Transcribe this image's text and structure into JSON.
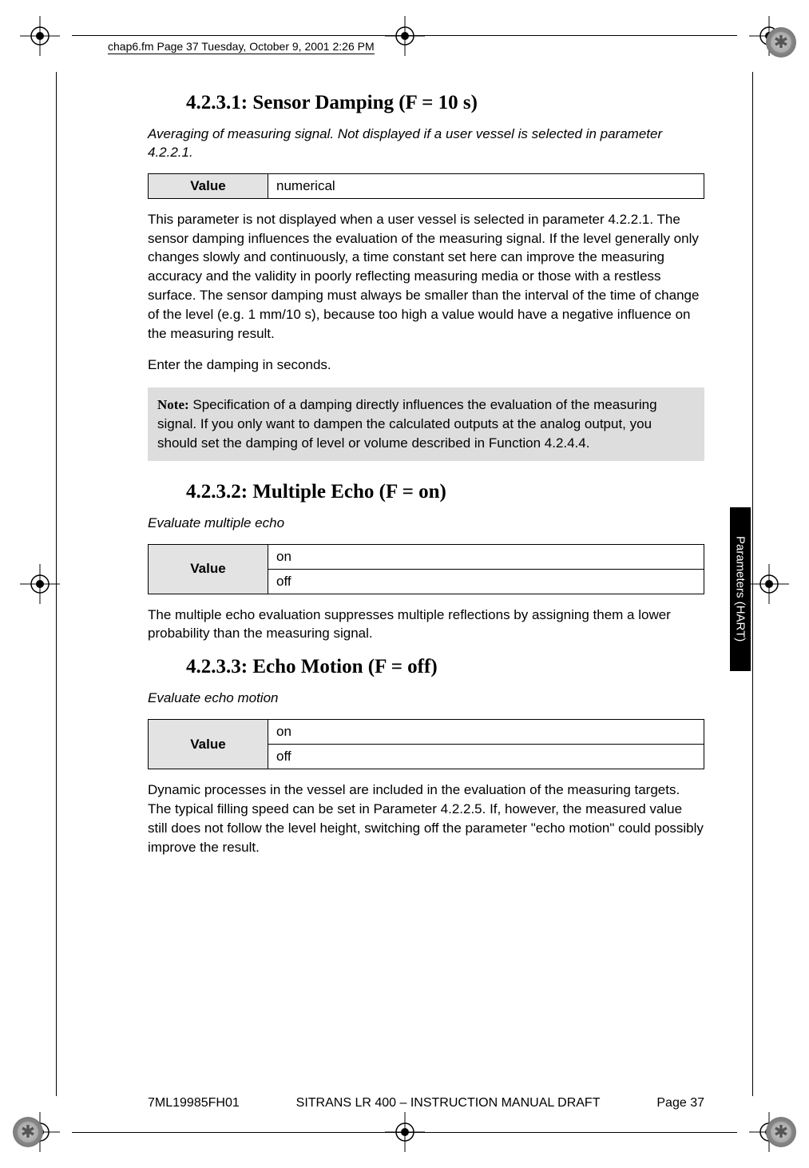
{
  "header_note": "chap6.fm  Page 37  Tuesday, October 9, 2001  2:26 PM",
  "side_tab": "Parameters (HART)",
  "sections": {
    "s1": {
      "heading": "4.2.3.1: Sensor Damping (F = 10 s)",
      "desc": "Averaging of measuring signal. Not displayed if a user vessel is selected in parameter 4.2.2.1.",
      "table_label": "Value",
      "table_val": "numerical",
      "para1": "This parameter is not displayed when a user vessel is selected in parameter 4.2.2.1. The sensor damping influences the evaluation of the measuring signal. If the level generally only changes slowly and continuously, a time constant set here can improve the measuring accuracy and the validity in poorly reflecting measuring media or those with a restless surface. The sensor damping must always be smaller than the interval of the time of change of the level (e.g. 1 mm/10 s), because too high a value would have a negative influence on the measuring result.",
      "para2": "Enter the damping in seconds.",
      "note_label": "Note:",
      "note_body": " Specification of a damping directly influences the evaluation of the measuring signal. If you only want to dampen the calculated outputs at the analog output, you should set the damping of level or volume described in Function 4.2.4.4."
    },
    "s2": {
      "heading": "4.2.3.2: Multiple Echo (F = on)",
      "desc": "Evaluate multiple echo",
      "table_label": "Value",
      "row1": "on",
      "row2": "off",
      "para": "The multiple echo evaluation suppresses multiple reflections by assigning them a lower probability than the measuring signal."
    },
    "s3": {
      "heading": "4.2.3.3: Echo Motion (F = off)",
      "desc": "Evaluate echo motion",
      "table_label": "Value",
      "row1": "on",
      "row2": "off",
      "para": "Dynamic processes in the vessel are included in the evaluation of the measuring targets. The typical filling speed can be set in Parameter 4.2.2.5. If, however, the measured value still does not follow the level height, switching off the parameter \"echo motion\" could possibly improve the result."
    }
  },
  "footer": {
    "left": "7ML19985FH01",
    "center": "SITRANS LR 400 – INSTRUCTION MANUAL DRAFT",
    "right": "Page 37"
  }
}
